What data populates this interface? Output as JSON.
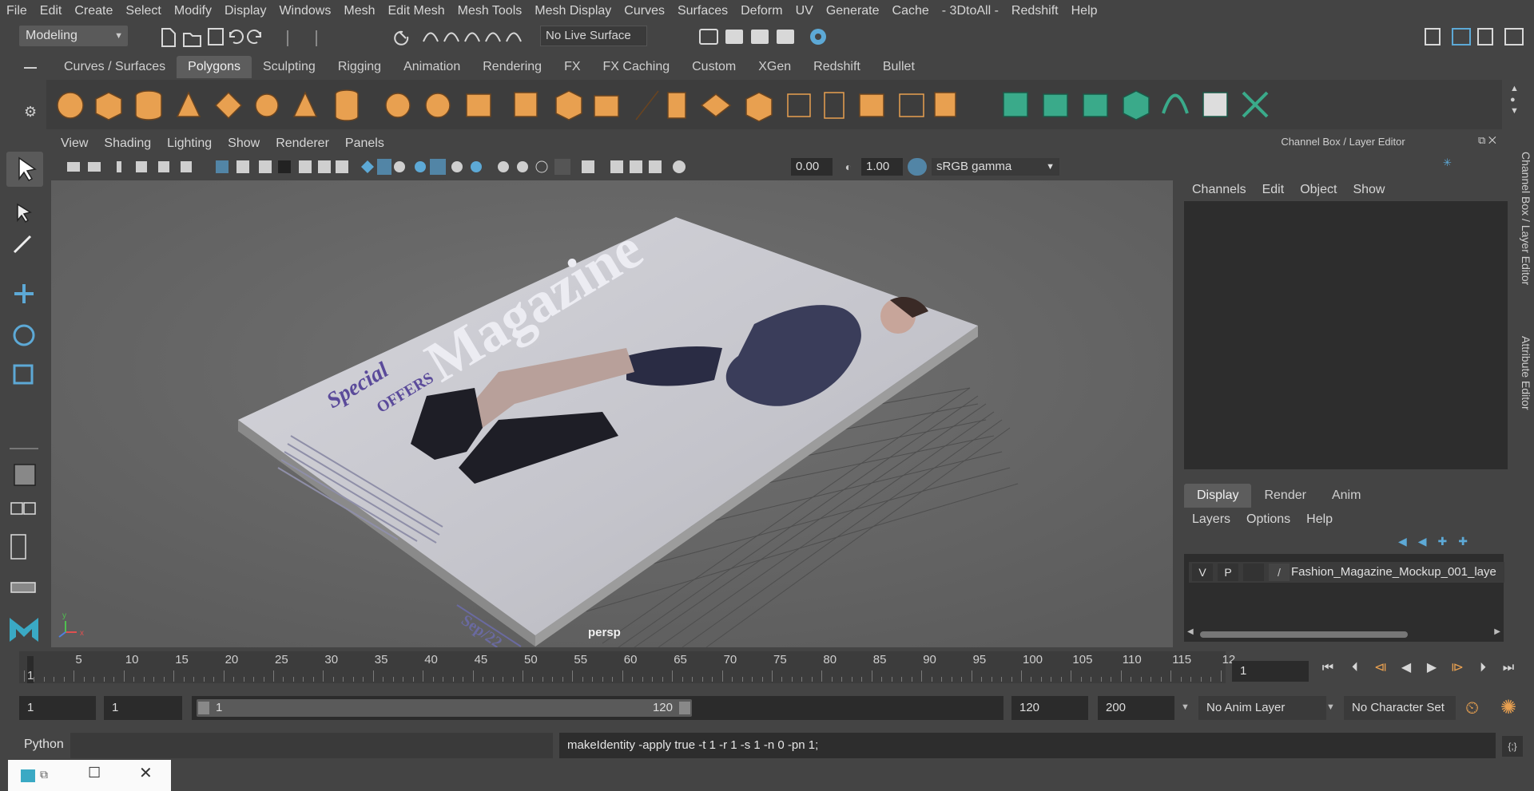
{
  "menubar": [
    "File",
    "Edit",
    "Create",
    "Select",
    "Modify",
    "Display",
    "Windows",
    "Mesh",
    "Edit Mesh",
    "Mesh Tools",
    "Mesh Display",
    "Curves",
    "Surfaces",
    "Deform",
    "UV",
    "Generate",
    "Cache",
    "- 3DtoAll -",
    "Redshift",
    "Help"
  ],
  "status": {
    "mode": "Modeling",
    "live_surface": "No Live Surface"
  },
  "shelf_tabs": [
    "Curves / Surfaces",
    "Polygons",
    "Sculpting",
    "Rigging",
    "Animation",
    "Rendering",
    "FX",
    "FX Caching",
    "Custom",
    "XGen",
    "Redshift",
    "Bullet"
  ],
  "shelf_active": "Polygons",
  "viewport": {
    "menu": [
      "View",
      "Shading",
      "Lighting",
      "Show",
      "Renderer",
      "Panels"
    ],
    "exposure": "0.00",
    "gamma": "1.00",
    "color_space": "sRGB gamma",
    "camera_label": "persp",
    "magazine": {
      "title": "Magazine",
      "special": "Special",
      "offers": "OFFERS",
      "date": "Sep/22"
    }
  },
  "channel_box": {
    "title": "Channel Box / Layer Editor",
    "menu": [
      "Channels",
      "Edit",
      "Object",
      "Show"
    ],
    "layer_tabs": [
      "Display",
      "Render",
      "Anim"
    ],
    "layer_tab_active": "Display",
    "layer_menu": [
      "Layers",
      "Options",
      "Help"
    ],
    "layer": {
      "v": "V",
      "p": "P",
      "name": "Fashion_Magazine_Mockup_001_laye"
    }
  },
  "side_tabs": [
    "Channel Box / Layer Editor",
    "Attribute Editor"
  ],
  "timeline": {
    "ticks": [
      "1",
      "5",
      "10",
      "15",
      "20",
      "25",
      "30",
      "35",
      "40",
      "45",
      "50",
      "55",
      "60",
      "65",
      "70",
      "75",
      "80",
      "85",
      "90",
      "95",
      "100",
      "105",
      "110",
      "115",
      "12"
    ],
    "current_frame": "1"
  },
  "range": {
    "start": "1",
    "playback_start": "1",
    "slider_start": "1",
    "slider_end": "120",
    "playback_end": "120",
    "end": "200",
    "anim_layer": "No Anim Layer",
    "character_set": "No Character Set"
  },
  "command": {
    "language": "Python",
    "output": "makeIdentity -apply true -t 1 -r 1 -s 1 -n 0 -pn 1;"
  },
  "colors": {
    "accent": "#5285a6",
    "shelf_orange": "#e8a050",
    "shelf_teal": "#3aaa8a",
    "viewport_bg": "#6b6b6b"
  }
}
